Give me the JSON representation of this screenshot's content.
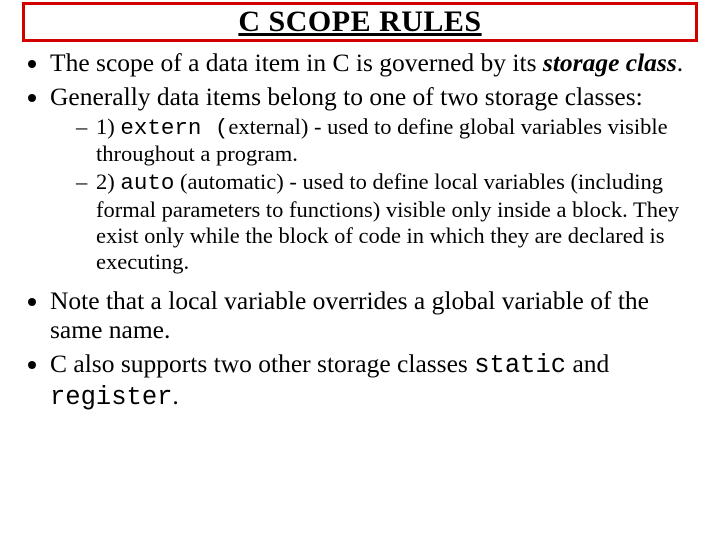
{
  "title": "C SCOPE RULES",
  "bullets": {
    "b1_pre": "The scope of a data item in C is governed by its ",
    "b1_emph": "storage class",
    "b1_post": ".",
    "b2": "Generally data items belong to one of two storage classes:",
    "s1_pre": "1) ",
    "s1_code": "extern (",
    "s1_post": "external) - used to define global variables visible throughout a program.",
    "s2_pre": "2) ",
    "s2_code": "auto",
    "s2_post": " (automatic) - used to define local variables (including formal parameters to functions) visible only inside a block. They exist only while the block of code in which they are declared is executing.",
    "b3": "Note that a local variable overrides a global variable of the same name.",
    "b4_pre": "C also supports two other storage classes ",
    "b4_code1": "static",
    "b4_mid": " and ",
    "b4_code2": "register",
    "b4_post": "."
  }
}
